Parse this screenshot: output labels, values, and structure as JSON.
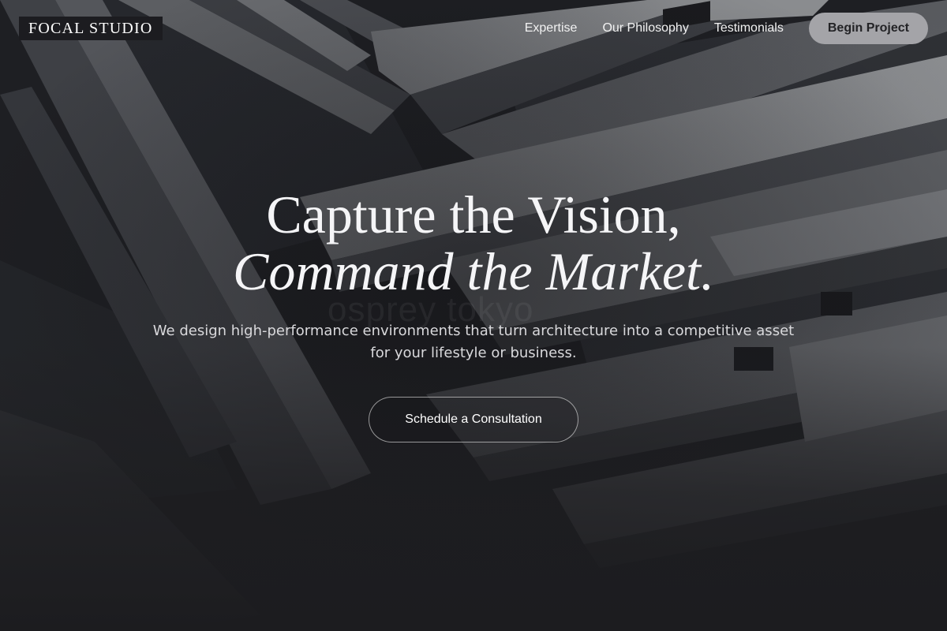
{
  "brand": {
    "logo_text": "FOCAL STUDIO"
  },
  "nav": {
    "links": [
      "Expertise",
      "Our Philosophy",
      "Testimonials"
    ],
    "cta_label": "Begin Project"
  },
  "hero": {
    "headline_line1": "Capture the Vision,",
    "headline_line2": "Command the Market.",
    "subtitle": "We design high-performance environments that turn architecture into a competitive asset for your lifestyle or business.",
    "button_label": "Schedule a Consultation",
    "watermark_text": "osprey tokyo"
  },
  "colors": {
    "background": "#1d1d20",
    "cta_pill": "#a4a4a8",
    "text": "#f5f5f7"
  }
}
